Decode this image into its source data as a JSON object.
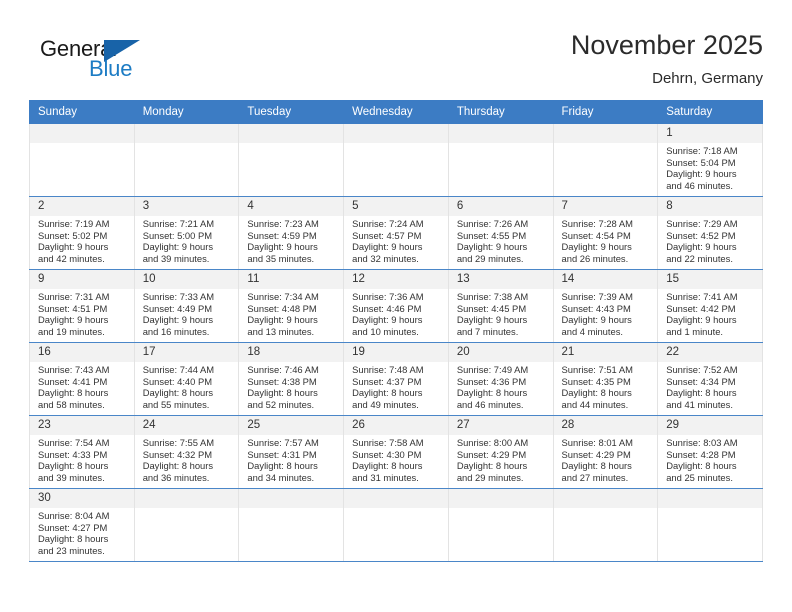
{
  "brand": {
    "name_part1": "General",
    "name_part2": "Blue",
    "accent_color": "#1d7cc4",
    "triangle_color": "#1863a8"
  },
  "header": {
    "month_title": "November 2025",
    "location": "Dehrn, Germany"
  },
  "theme": {
    "header_row_bg": "#3c7cc4",
    "day_band_bg": "#f2f2f2",
    "row_divider": "#4a86c8"
  },
  "weekday_headers": [
    "Sunday",
    "Monday",
    "Tuesday",
    "Wednesday",
    "Thursday",
    "Friday",
    "Saturday"
  ],
  "weeks": [
    [
      {
        "blank": true,
        "day": ""
      },
      {
        "blank": true,
        "day": ""
      },
      {
        "blank": true,
        "day": ""
      },
      {
        "blank": true,
        "day": ""
      },
      {
        "blank": true,
        "day": ""
      },
      {
        "blank": true,
        "day": ""
      },
      {
        "day": "1",
        "sunrise": "Sunrise: 7:18 AM",
        "sunset": "Sunset: 5:04 PM",
        "daylight_line1": "Daylight: 9 hours",
        "daylight_line2": "and 46 minutes."
      }
    ],
    [
      {
        "day": "2",
        "sunrise": "Sunrise: 7:19 AM",
        "sunset": "Sunset: 5:02 PM",
        "daylight_line1": "Daylight: 9 hours",
        "daylight_line2": "and 42 minutes."
      },
      {
        "day": "3",
        "sunrise": "Sunrise: 7:21 AM",
        "sunset": "Sunset: 5:00 PM",
        "daylight_line1": "Daylight: 9 hours",
        "daylight_line2": "and 39 minutes."
      },
      {
        "day": "4",
        "sunrise": "Sunrise: 7:23 AM",
        "sunset": "Sunset: 4:59 PM",
        "daylight_line1": "Daylight: 9 hours",
        "daylight_line2": "and 35 minutes."
      },
      {
        "day": "5",
        "sunrise": "Sunrise: 7:24 AM",
        "sunset": "Sunset: 4:57 PM",
        "daylight_line1": "Daylight: 9 hours",
        "daylight_line2": "and 32 minutes."
      },
      {
        "day": "6",
        "sunrise": "Sunrise: 7:26 AM",
        "sunset": "Sunset: 4:55 PM",
        "daylight_line1": "Daylight: 9 hours",
        "daylight_line2": "and 29 minutes."
      },
      {
        "day": "7",
        "sunrise": "Sunrise: 7:28 AM",
        "sunset": "Sunset: 4:54 PM",
        "daylight_line1": "Daylight: 9 hours",
        "daylight_line2": "and 26 minutes."
      },
      {
        "day": "8",
        "sunrise": "Sunrise: 7:29 AM",
        "sunset": "Sunset: 4:52 PM",
        "daylight_line1": "Daylight: 9 hours",
        "daylight_line2": "and 22 minutes."
      }
    ],
    [
      {
        "day": "9",
        "sunrise": "Sunrise: 7:31 AM",
        "sunset": "Sunset: 4:51 PM",
        "daylight_line1": "Daylight: 9 hours",
        "daylight_line2": "and 19 minutes."
      },
      {
        "day": "10",
        "sunrise": "Sunrise: 7:33 AM",
        "sunset": "Sunset: 4:49 PM",
        "daylight_line1": "Daylight: 9 hours",
        "daylight_line2": "and 16 minutes."
      },
      {
        "day": "11",
        "sunrise": "Sunrise: 7:34 AM",
        "sunset": "Sunset: 4:48 PM",
        "daylight_line1": "Daylight: 9 hours",
        "daylight_line2": "and 13 minutes."
      },
      {
        "day": "12",
        "sunrise": "Sunrise: 7:36 AM",
        "sunset": "Sunset: 4:46 PM",
        "daylight_line1": "Daylight: 9 hours",
        "daylight_line2": "and 10 minutes."
      },
      {
        "day": "13",
        "sunrise": "Sunrise: 7:38 AM",
        "sunset": "Sunset: 4:45 PM",
        "daylight_line1": "Daylight: 9 hours",
        "daylight_line2": "and 7 minutes."
      },
      {
        "day": "14",
        "sunrise": "Sunrise: 7:39 AM",
        "sunset": "Sunset: 4:43 PM",
        "daylight_line1": "Daylight: 9 hours",
        "daylight_line2": "and 4 minutes."
      },
      {
        "day": "15",
        "sunrise": "Sunrise: 7:41 AM",
        "sunset": "Sunset: 4:42 PM",
        "daylight_line1": "Daylight: 9 hours",
        "daylight_line2": "and 1 minute."
      }
    ],
    [
      {
        "day": "16",
        "sunrise": "Sunrise: 7:43 AM",
        "sunset": "Sunset: 4:41 PM",
        "daylight_line1": "Daylight: 8 hours",
        "daylight_line2": "and 58 minutes."
      },
      {
        "day": "17",
        "sunrise": "Sunrise: 7:44 AM",
        "sunset": "Sunset: 4:40 PM",
        "daylight_line1": "Daylight: 8 hours",
        "daylight_line2": "and 55 minutes."
      },
      {
        "day": "18",
        "sunrise": "Sunrise: 7:46 AM",
        "sunset": "Sunset: 4:38 PM",
        "daylight_line1": "Daylight: 8 hours",
        "daylight_line2": "and 52 minutes."
      },
      {
        "day": "19",
        "sunrise": "Sunrise: 7:48 AM",
        "sunset": "Sunset: 4:37 PM",
        "daylight_line1": "Daylight: 8 hours",
        "daylight_line2": "and 49 minutes."
      },
      {
        "day": "20",
        "sunrise": "Sunrise: 7:49 AM",
        "sunset": "Sunset: 4:36 PM",
        "daylight_line1": "Daylight: 8 hours",
        "daylight_line2": "and 46 minutes."
      },
      {
        "day": "21",
        "sunrise": "Sunrise: 7:51 AM",
        "sunset": "Sunset: 4:35 PM",
        "daylight_line1": "Daylight: 8 hours",
        "daylight_line2": "and 44 minutes."
      },
      {
        "day": "22",
        "sunrise": "Sunrise: 7:52 AM",
        "sunset": "Sunset: 4:34 PM",
        "daylight_line1": "Daylight: 8 hours",
        "daylight_line2": "and 41 minutes."
      }
    ],
    [
      {
        "day": "23",
        "sunrise": "Sunrise: 7:54 AM",
        "sunset": "Sunset: 4:33 PM",
        "daylight_line1": "Daylight: 8 hours",
        "daylight_line2": "and 39 minutes."
      },
      {
        "day": "24",
        "sunrise": "Sunrise: 7:55 AM",
        "sunset": "Sunset: 4:32 PM",
        "daylight_line1": "Daylight: 8 hours",
        "daylight_line2": "and 36 minutes."
      },
      {
        "day": "25",
        "sunrise": "Sunrise: 7:57 AM",
        "sunset": "Sunset: 4:31 PM",
        "daylight_line1": "Daylight: 8 hours",
        "daylight_line2": "and 34 minutes."
      },
      {
        "day": "26",
        "sunrise": "Sunrise: 7:58 AM",
        "sunset": "Sunset: 4:30 PM",
        "daylight_line1": "Daylight: 8 hours",
        "daylight_line2": "and 31 minutes."
      },
      {
        "day": "27",
        "sunrise": "Sunrise: 8:00 AM",
        "sunset": "Sunset: 4:29 PM",
        "daylight_line1": "Daylight: 8 hours",
        "daylight_line2": "and 29 minutes."
      },
      {
        "day": "28",
        "sunrise": "Sunrise: 8:01 AM",
        "sunset": "Sunset: 4:29 PM",
        "daylight_line1": "Daylight: 8 hours",
        "daylight_line2": "and 27 minutes."
      },
      {
        "day": "29",
        "sunrise": "Sunrise: 8:03 AM",
        "sunset": "Sunset: 4:28 PM",
        "daylight_line1": "Daylight: 8 hours",
        "daylight_line2": "and 25 minutes."
      }
    ],
    [
      {
        "day": "30",
        "sunrise": "Sunrise: 8:04 AM",
        "sunset": "Sunset: 4:27 PM",
        "daylight_line1": "Daylight: 8 hours",
        "daylight_line2": "and 23 minutes."
      },
      {
        "blank": true,
        "day": ""
      },
      {
        "blank": true,
        "day": ""
      },
      {
        "blank": true,
        "day": ""
      },
      {
        "blank": true,
        "day": ""
      },
      {
        "blank": true,
        "day": ""
      },
      {
        "blank": true,
        "day": ""
      }
    ]
  ]
}
